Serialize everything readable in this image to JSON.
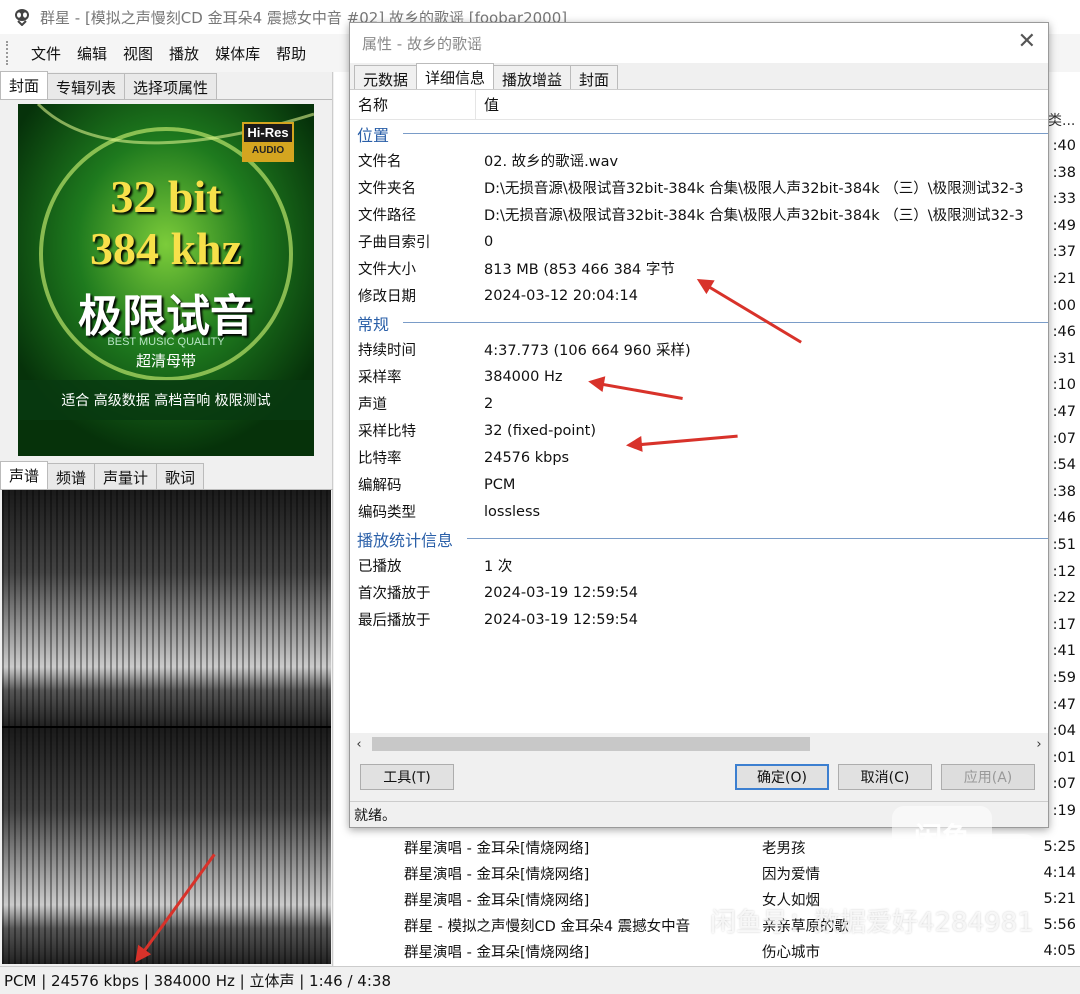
{
  "window": {
    "title": "群星 - [模拟之声慢刻CD 金耳朵4 震撼女中音 #02] 故乡的歌谣 [foobar2000]"
  },
  "menu": [
    "文件",
    "编辑",
    "视图",
    "播放",
    "媒体库",
    "帮助"
  ],
  "left_tabs_top": [
    "封面",
    "专辑列表",
    "选择项属性"
  ],
  "left_tabs_bottom": [
    "声谱",
    "频谱",
    "声量计",
    "歌词"
  ],
  "cover": {
    "badge_top": "Hi-Res",
    "badge_bottom": "AUDIO",
    "line1": "32 bit",
    "line2": "384 khz",
    "line3": "极限试音",
    "line4": "BEST MUSIC QUALITY",
    "line5": "超清母带",
    "footer": "适合 高级数据 高档音响 极限测试"
  },
  "dialog": {
    "title": "属性 - 故乡的歌谣",
    "tabs": [
      "元数据",
      "详细信息",
      "播放增益",
      "封面"
    ],
    "header": {
      "name": "名称",
      "value": "值"
    },
    "sections": [
      {
        "title": "位置",
        "rows": [
          {
            "k": "文件名",
            "v": "02. 故乡的歌谣.wav"
          },
          {
            "k": "文件夹名",
            "v": "D:\\无损音源\\极限试音32bit-384k 合集\\极限人声32bit-384k （三）\\极限测试32-3"
          },
          {
            "k": "文件路径",
            "v": "D:\\无损音源\\极限试音32bit-384k 合集\\极限人声32bit-384k （三）\\极限测试32-3"
          },
          {
            "k": "子曲目索引",
            "v": "0"
          },
          {
            "k": "文件大小",
            "v": "813 MB (853 466 384 字节"
          },
          {
            "k": "修改日期",
            "v": "2024-03-12 20:04:14"
          }
        ]
      },
      {
        "title": "常规",
        "rows": [
          {
            "k": "持续时间",
            "v": "4:37.773 (106 664 960 采样)"
          },
          {
            "k": "采样率",
            "v": "384000 Hz"
          },
          {
            "k": "声道",
            "v": "2"
          },
          {
            "k": "采样比特",
            "v": "32 (fixed-point)"
          },
          {
            "k": "比特率",
            "v": "24576 kbps"
          },
          {
            "k": "编解码",
            "v": "PCM"
          },
          {
            "k": "编码类型",
            "v": "lossless"
          }
        ]
      },
      {
        "title": "播放统计信息",
        "rows": [
          {
            "k": "已播放",
            "v": "1 次"
          },
          {
            "k": "首次播放于",
            "v": "2024-03-19 12:59:54"
          },
          {
            "k": "最后播放于",
            "v": "2024-03-19 12:59:54"
          }
        ]
      }
    ],
    "buttons": {
      "tools": "工具(T)",
      "ok": "确定(O)",
      "cancel": "取消(C)",
      "apply": "应用(A)"
    },
    "status": "就绪。"
  },
  "playlist_header": "类...",
  "durations_right": [
    ":40",
    ":38",
    ":33",
    ":49",
    ":37",
    ":21",
    ":00",
    ":46",
    ":31",
    ":10",
    ":47",
    ":07",
    ":54",
    ":38",
    ":46",
    ":51",
    ":12",
    ":22",
    ":17",
    ":41",
    ":59",
    ":47",
    ":04",
    ":01",
    ":07",
    ":19"
  ],
  "playlist_rows": [
    {
      "artist": "群星演唱 - 金耳朵[情烧网络]",
      "title": "老男孩",
      "dur": "5:25"
    },
    {
      "artist": "群星演唱 - 金耳朵[情烧网络]",
      "title": "因为爱情",
      "dur": "4:14"
    },
    {
      "artist": "群星演唱 - 金耳朵[情烧网络]",
      "title": "女人如烟",
      "dur": "5:21"
    },
    {
      "artist": "群星 - 模拟之声慢刻CD 金耳朵4 震撼女中音",
      "title": "亲亲草原的歌",
      "dur": "5:56"
    },
    {
      "artist": "群星演唱 - 金耳朵[情烧网络]",
      "title": "伤心城市",
      "dur": "4:05"
    }
  ],
  "statusbar": "PCM | 24576 kbps | 384000 Hz | 立体声 | 1:46 / 4:38",
  "watermark": {
    "logo1": "闲鱼",
    "logo2": "闲鱼",
    "text": "闲鱼号：数据爱好4284981"
  }
}
